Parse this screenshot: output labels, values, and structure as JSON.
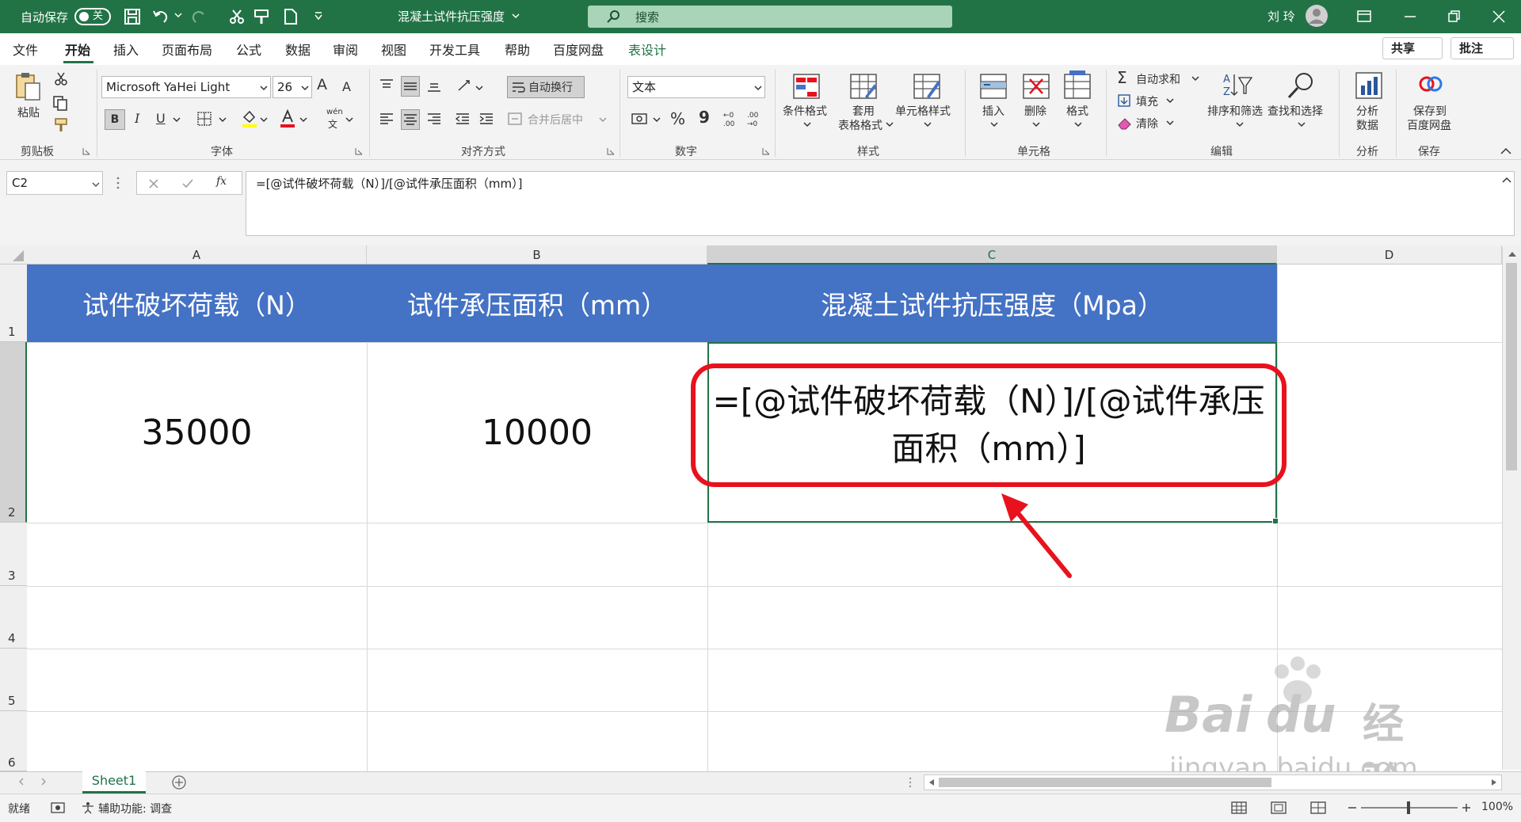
{
  "titlebar": {
    "autosave_label": "自动保存",
    "autosave_state": "关",
    "document_title": "混凝土试件抗压强度",
    "search_placeholder": "搜索",
    "user_name": "刘 玲"
  },
  "menu": {
    "items": [
      "文件",
      "开始",
      "插入",
      "页面布局",
      "公式",
      "数据",
      "审阅",
      "视图",
      "开发工具",
      "帮助",
      "百度网盘",
      "表设计"
    ],
    "active": "开始",
    "share_label": "共享",
    "comments_label": "批注"
  },
  "ribbon": {
    "clipboard": {
      "paste": "粘贴",
      "group": "剪贴板"
    },
    "font": {
      "name": "Microsoft YaHei Light",
      "size": "26",
      "group": "字体",
      "bold": "B",
      "italic": "I",
      "underline": "U",
      "grow": "A",
      "shrink": "A",
      "phonetic_top": "wén",
      "phonetic_bottom": "文"
    },
    "alignment": {
      "wrap": "自动换行",
      "merge": "合并后居中",
      "group": "对齐方式"
    },
    "number": {
      "format": "文本",
      "group": "数字",
      "percent": "%",
      "comma": "9"
    },
    "styles": {
      "conditional": "条件格式",
      "table_1": "套用",
      "table_2": "表格格式",
      "cell_styles": "单元格样式",
      "group": "样式"
    },
    "cells": {
      "insert": "插入",
      "delete": "删除",
      "format": "格式",
      "group": "单元格"
    },
    "editing": {
      "autosum": "自动求和",
      "fill": "填充",
      "clear": "清除",
      "sort": "排序和筛选",
      "find": "查找和选择",
      "group": "编辑"
    },
    "analysis": {
      "label_1": "分析",
      "label_2": "数据",
      "group": "分析"
    },
    "save": {
      "label_1": "保存到",
      "label_2": "百度网盘",
      "group": "保存"
    }
  },
  "formula_bar": {
    "name_box": "C2",
    "fx": "fx",
    "formula": "=[@试件破坏荷载（N）]/[@试件承压面积（mm）]"
  },
  "sheet": {
    "columns": [
      "A",
      "B",
      "C",
      "D"
    ],
    "rows": [
      "1",
      "2",
      "3",
      "4",
      "5",
      "6"
    ],
    "headers": [
      "试件破坏荷载（N）",
      "试件承压面积（mm）",
      "混凝土试件抗压强度（Mpa）"
    ],
    "row2": {
      "a": "35000",
      "b": "10000",
      "c": "=[@试件破坏荷载（N）]/[@试件承压面积（mm）]"
    },
    "header_color": "#4472c4",
    "highlight_color": "#e8121e"
  },
  "tabs": {
    "sheet1": "Sheet1"
  },
  "status": {
    "ready": "就绪",
    "accessibility": "辅助功能: 调查",
    "zoom": "100%"
  },
  "watermark": {
    "brand": "Bai",
    "brand2": "du",
    "brand_cn": "经验",
    "url": "jingyan.baidu.com"
  }
}
